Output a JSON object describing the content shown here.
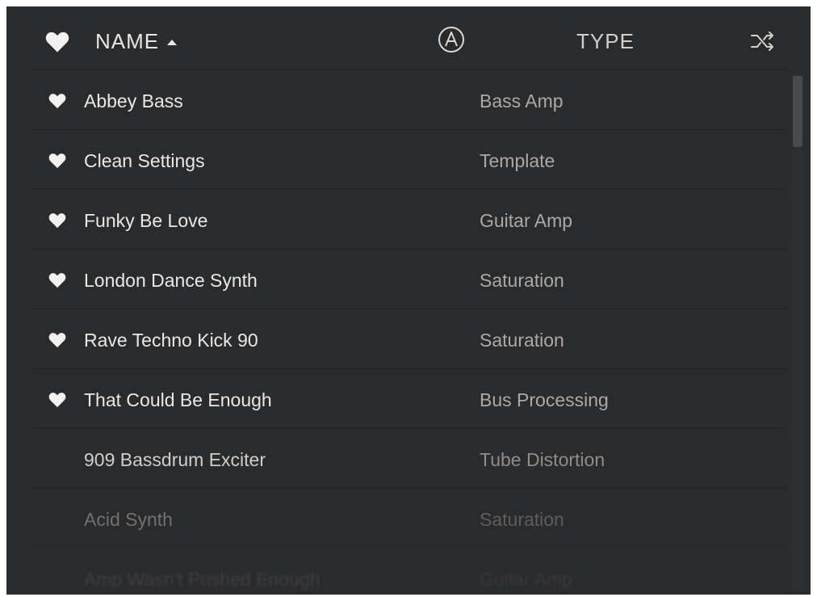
{
  "header": {
    "name_label": "NAME",
    "type_label": "TYPE",
    "sort_direction": "ascending"
  },
  "icons": {
    "favorite": "heart-icon",
    "arturia": "arturia-logo-icon",
    "shuffle": "shuffle-icon"
  },
  "colors": {
    "panel_bg": "#2a2b2d",
    "text_primary": "#e8e8e8",
    "text_secondary": "#a9a9a9"
  },
  "presets": [
    {
      "name": "Abbey Bass",
      "type": "Bass Amp",
      "favorite": true
    },
    {
      "name": "Clean Settings",
      "type": "Template",
      "favorite": true
    },
    {
      "name": "Funky Be Love",
      "type": "Guitar Amp",
      "favorite": true
    },
    {
      "name": "London Dance Synth",
      "type": "Saturation",
      "favorite": true
    },
    {
      "name": "Rave Techno Kick 90",
      "type": "Saturation",
      "favorite": true
    },
    {
      "name": "That Could Be Enough",
      "type": "Bus Processing",
      "favorite": true
    },
    {
      "name": "909 Bassdrum Exciter",
      "type": "Tube Distortion",
      "favorite": false
    },
    {
      "name": "Acid Synth",
      "type": "Saturation",
      "favorite": false
    },
    {
      "name": "Amp Wasn't Pushed Enough",
      "type": "Guitar Amp",
      "favorite": false
    }
  ]
}
